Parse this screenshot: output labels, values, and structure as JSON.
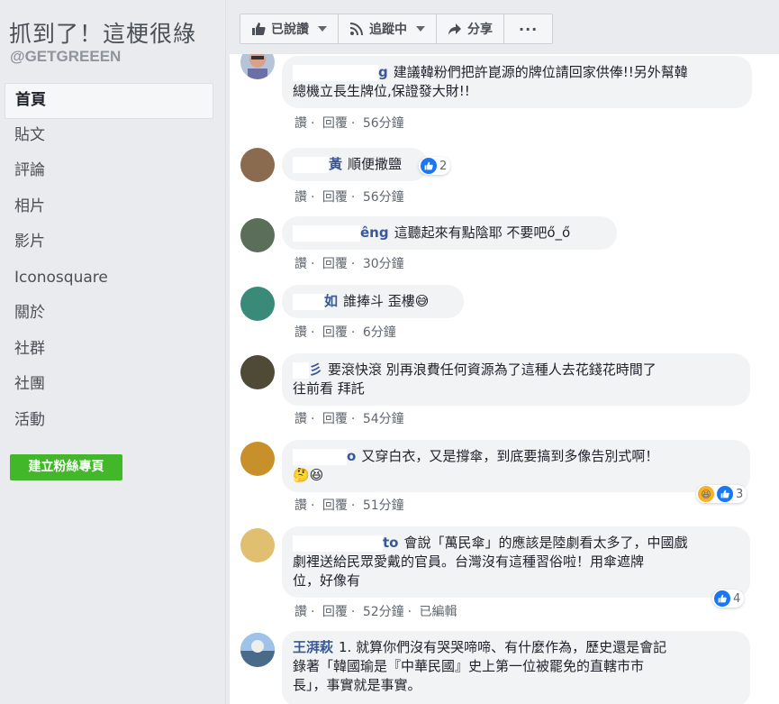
{
  "page": {
    "name": "抓到了！這梗很綠",
    "handle": "@GETGREEEN"
  },
  "nav": {
    "items": [
      "首頁",
      "貼文",
      "評論",
      "相片",
      "影片",
      "Iconosquare",
      "關於",
      "社群",
      "社團",
      "活動"
    ],
    "create_label": "建立粉絲專頁"
  },
  "actions": {
    "liked_label": "已說讚",
    "follow_label": "追蹤中",
    "share_label": "分享",
    "more_label": "···"
  },
  "comments": [
    {
      "author": "g",
      "text_line1": "建議韓粉們把許崑源的牌位請回家供俸!!另外幫韓",
      "text_line2": "總機立長生牌位,保證發大財!!",
      "like": "讚",
      "reply": "回覆",
      "time": "56分鐘"
    },
    {
      "author": "黃",
      "text_line1": "順便撒鹽",
      "like": "讚",
      "reply": "回覆",
      "time": "56分鐘",
      "reactions": "2"
    },
    {
      "author": "êng",
      "text_line1": "這聽起來有點陰耶 不要吧ő_ő",
      "like": "讚",
      "reply": "回覆",
      "time": "30分鐘"
    },
    {
      "author": "如",
      "text_line1": "誰捧斗 歪樓😅",
      "like": "讚",
      "reply": "回覆",
      "time": "6分鐘"
    },
    {
      "author": "彡",
      "text_line1": "要滾快滾 別再浪費任何資源為了這種人去花錢花時間了",
      "text_line2": "往前看 拜託",
      "like": "讚",
      "reply": "回覆",
      "time": "54分鐘"
    },
    {
      "author": "o",
      "text_line1": "又穿白衣，又是撐傘，到底要搞到多像告別式啊！",
      "text_line2": "🤔😆",
      "like": "讚",
      "reply": "回覆",
      "time": "51分鐘",
      "reactions": "3"
    },
    {
      "author": "to",
      "text_line1": "會說「萬民傘」的應該是陸劇看太多了，中國戲",
      "text_line2": "劇裡送給民眾愛戴的官員。台灣沒有這種習俗啦！用傘遮牌",
      "text_line3": "位，好像有",
      "like": "讚",
      "reply": "回覆",
      "time": "52分鐘",
      "edited": "已編輯",
      "reactions": "4"
    },
    {
      "author": "王湃萩",
      "text_line1": "1. 就算你們沒有哭哭啼啼、有什麼作為，歷史還是會記",
      "text_line2": "錄著「韓國瑜是『中華民國』史上第一位被罷免的直轄市市",
      "text_line3": "長」，事實就是事實。"
    }
  ],
  "colors": {
    "link": "#385898",
    "green": "#42b72a",
    "like_blue": "#1877f2",
    "bubble": "#f2f3f5"
  },
  "icons": [
    "thumbs-up-icon",
    "rss-icon",
    "share-arrow-icon",
    "more-icon",
    "caret-down-icon"
  ]
}
